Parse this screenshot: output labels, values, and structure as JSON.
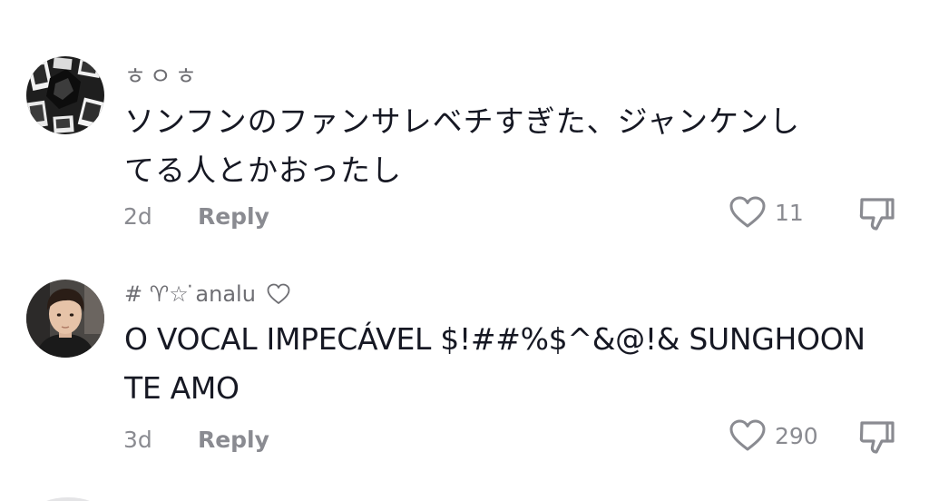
{
  "comments": [
    {
      "username": "ㅎㅇㅎ",
      "text_line1": "ソンフンのファンサレベチすぎた、ジャンケンし",
      "text_line2": "てる人とかおったし",
      "age": "2d",
      "reply_label": "Reply",
      "likes": "11",
      "avatar_icon": "collage-avatar"
    },
    {
      "username": "# ♈︎☆ ̇analu",
      "text_line1": "O VOCAL IMPECÁVEL $!##%$^&@!& SUNGHOON",
      "text_line2": "TE AMO",
      "age": "3d",
      "reply_label": "Reply",
      "likes": "290",
      "avatar_icon": "portrait-avatar"
    }
  ],
  "colors": {
    "text_primary": "#161823",
    "text_secondary": "#8a8b91",
    "background": "#ffffff"
  }
}
